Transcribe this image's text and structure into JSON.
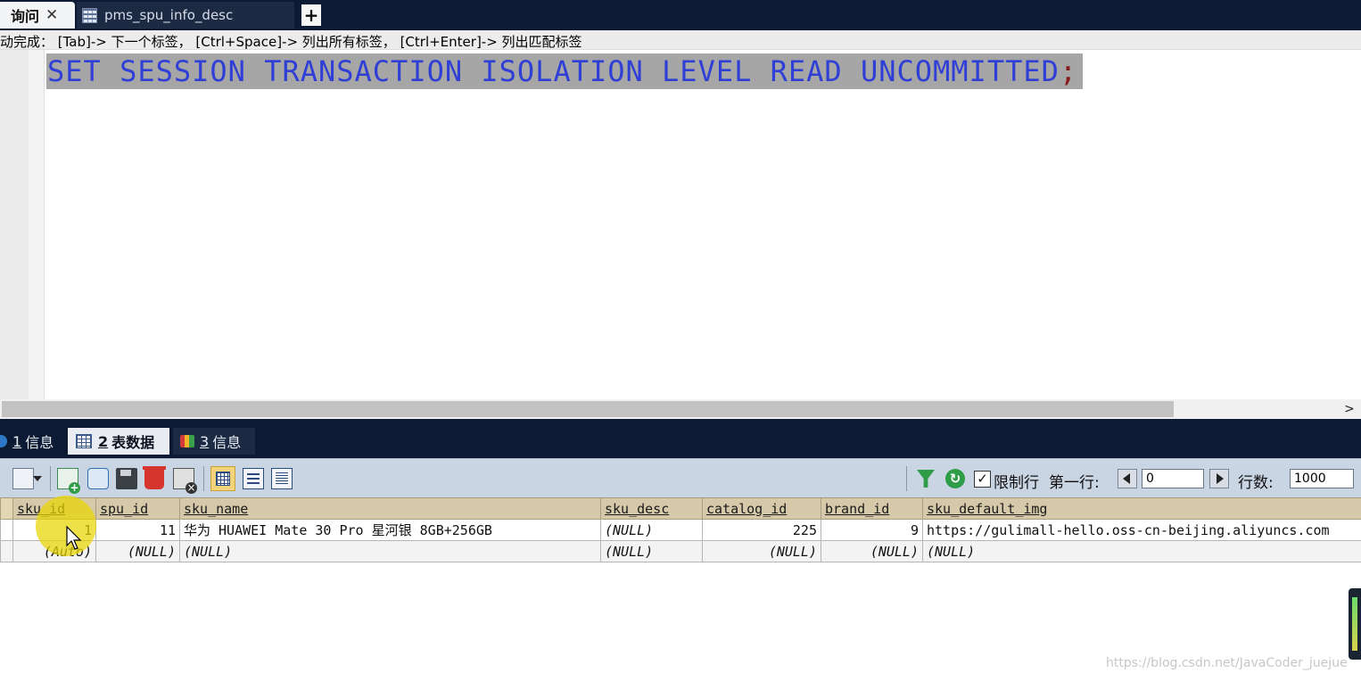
{
  "tabs": {
    "query_label": "询问",
    "close_glyph": "✕",
    "table_tab_label": "pms_spu_info_desc",
    "add_glyph": "+"
  },
  "hint": {
    "text": "动完成：  [Tab]-> 下一个标签，  [Ctrl+Space]-> 列出所有标签，  [Ctrl+Enter]-> 列出匹配标签"
  },
  "editor": {
    "sql": "SET SESSION TRANSACTION ISOLATION LEVEL READ UNCOMMITTED",
    "semicolon": ";"
  },
  "result_tabs": [
    {
      "num": "1",
      "label": "信息"
    },
    {
      "num": "2",
      "label": "表数据"
    },
    {
      "num": "3",
      "label": "信息"
    }
  ],
  "toolbar": {
    "limit_label": "限制行",
    "limit_checked": "✓",
    "first_row_label": "第一行:",
    "first_row_value": "0",
    "rows_label": "行数:",
    "rows_value": "1000",
    "refresh_glyph": "↻"
  },
  "grid": {
    "columns": [
      "sku_id",
      "spu_id",
      "sku_name",
      "sku_desc",
      "catalog_id",
      "brand_id",
      "sku_default_img"
    ],
    "rows": [
      [
        "1",
        "11",
        "华为 HUAWEI Mate 30 Pro 星河银 8GB+256GB",
        "(NULL)",
        "225",
        "9",
        "https://gulimall-hello.oss-cn-beijing.aliyuncs.com"
      ],
      [
        "(Auto)",
        "(NULL)",
        "(NULL)",
        "(NULL)",
        "(NULL)",
        "(NULL)",
        "(NULL)"
      ]
    ]
  },
  "watermark": "https://blog.csdn.net/JavaCoder_juejue",
  "colors": {
    "tab_bar": "#0d1a33",
    "sql_keyword": "#2f3fd6",
    "selection": "#a6a6a6",
    "grid_header": "#d6c9a9",
    "toolbar": "#c9d5e3"
  }
}
